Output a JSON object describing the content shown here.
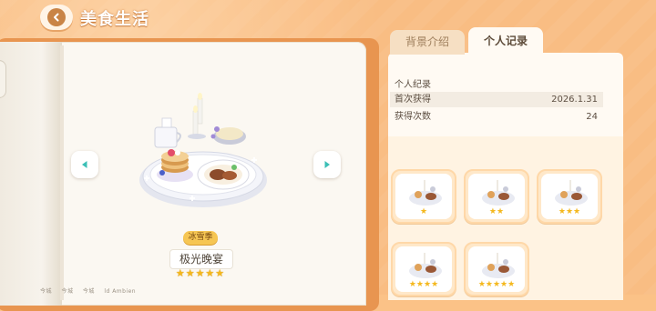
{
  "header": {
    "title": "美食生活",
    "back_icon": "chevron-left-icon"
  },
  "dish": {
    "season_badge": "冰雪季",
    "name": "极光晚宴",
    "stars": "★★★★★",
    "credits": [
      "今城",
      "今城",
      "今城",
      "ld Ambien"
    ]
  },
  "tabs": [
    {
      "label": "背景介绍",
      "active": false
    },
    {
      "label": "个人记录",
      "active": true
    }
  ],
  "record": {
    "section_title": "个人纪录",
    "rows": [
      {
        "label": "首次获得",
        "value": "2026.1.31"
      },
      {
        "label": "获得次数",
        "value": "24"
      }
    ]
  },
  "variants": [
    {
      "stars": "★"
    },
    {
      "stars": "★★"
    },
    {
      "stars": "★★★"
    },
    {
      "stars": "★★★★"
    },
    {
      "stars": "★★★★★"
    }
  ],
  "colors": {
    "background": "#f9bd83",
    "accent": "#e89550",
    "star": "#f4b81e",
    "badge": "#f6c653"
  }
}
